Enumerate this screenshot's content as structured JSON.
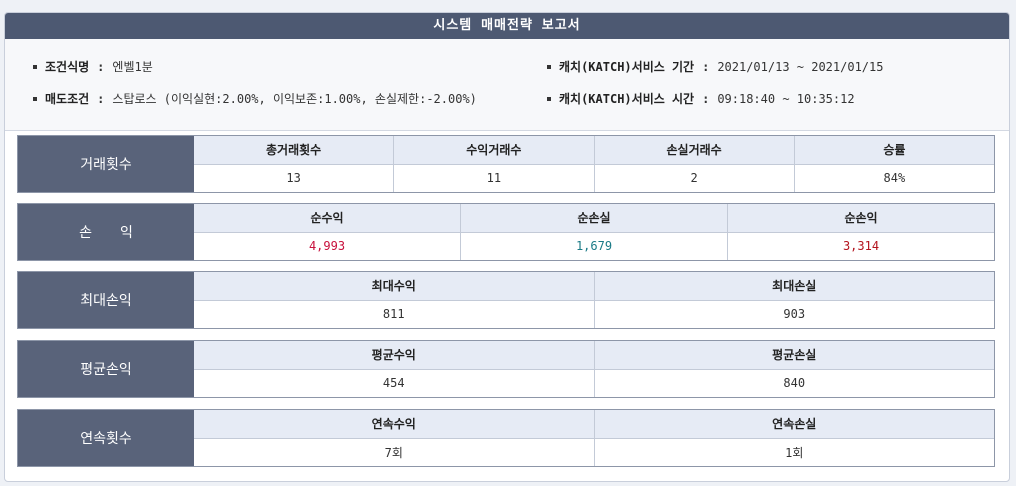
{
  "title": "시스템 매매전략 보고서",
  "info": {
    "condition_name": {
      "label": "조건식명",
      "value": "엔벨1분"
    },
    "sell_condition": {
      "label": "매도조건",
      "value": "스탑로스 (이익실현:2.00%, 이익보존:1.00%, 손실제한:-2.00%)"
    },
    "service_period": {
      "label": "캐치(KATCH)서비스 기간",
      "value": "2021/01/13 ~ 2021/01/15"
    },
    "service_time": {
      "label": "캐치(KATCH)서비스 시간",
      "value": "09:18:40 ~ 10:35:12"
    }
  },
  "sections": {
    "trade_count": {
      "label": "거래횟수",
      "headers": [
        "총거래횟수",
        "수익거래수",
        "손실거래수",
        "승률"
      ],
      "values": [
        "13",
        "11",
        "2",
        "84%"
      ]
    },
    "pnl": {
      "label": "손　　익",
      "headers": [
        "순수익",
        "순손실",
        "순손익"
      ],
      "values": [
        "4,993",
        "1,679",
        "3,314"
      ]
    },
    "max_pnl": {
      "label": "최대손익",
      "headers": [
        "최대수익",
        "최대손실"
      ],
      "values": [
        "811",
        "903"
      ]
    },
    "avg_pnl": {
      "label": "평균손익",
      "headers": [
        "평균수익",
        "평균손실"
      ],
      "values": [
        "454",
        "840"
      ]
    },
    "streak": {
      "label": "연속횟수",
      "headers": [
        "연속수익",
        "연속손실"
      ],
      "values": [
        "7회",
        "1회"
      ]
    }
  },
  "colors": {
    "title_bar": "#4d5972",
    "section_label": "#59637a",
    "header_cell": "#e6ebf5",
    "net_profit": "#c8103c",
    "net_loss": "#1a7a86",
    "net_pnl": "#b4141e"
  }
}
